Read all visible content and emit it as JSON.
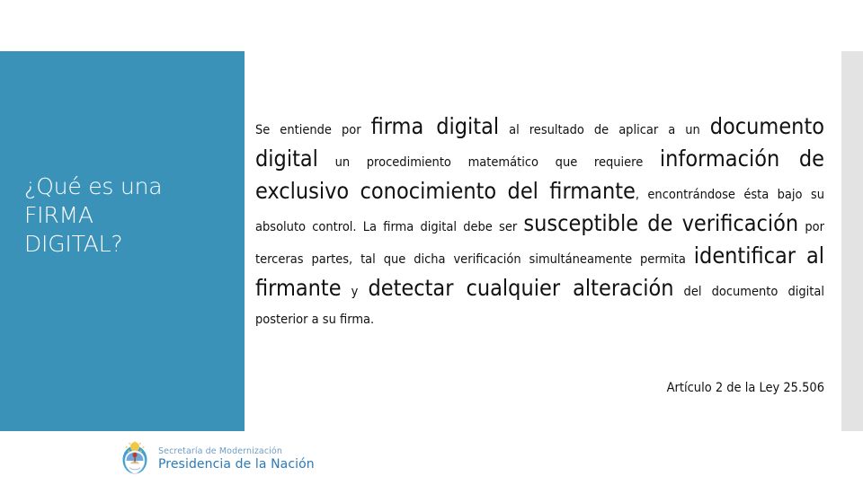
{
  "slide": {
    "background_color": "#ffffff",
    "panel_color": "#3b92b8",
    "strip_color": "#e3e3e3",
    "text_color": "#111111"
  },
  "title": {
    "line1": "¿Qué es una",
    "line2": "FIRMA",
    "line3": "DIGITAL?"
  },
  "body": {
    "r1": "Se entiende por ",
    "r2": "firma digital",
    "r3": " al resultado de aplicar a un ",
    "r4": "documento digital",
    "r5": " un procedimiento matemático que requiere ",
    "r6": "información de exclusivo conocimiento del firmante",
    "r7": ", encontrándose ésta bajo su absoluto control. La firma digital debe ser ",
    "r8": "susceptible de verificación",
    "r9": " por terceras partes, tal que dicha verificación simultáneamente permita ",
    "r10": "identificar al firmante",
    "r11": " y ",
    "r12": "detectar cualquier alteración",
    "r13": " del documento digital posterior a su firma."
  },
  "attribution": {
    "text": "Artículo 2 de la Ley 25.506"
  },
  "footer": {
    "logo_line1": "Secretaría de Modernización",
    "logo_line2": "Presidencia de la Nación",
    "logo_line1_color": "#6f9dc4",
    "logo_line2_color": "#2a7ab8",
    "emblem_name": "argentina-coat-of-arms-icon"
  }
}
